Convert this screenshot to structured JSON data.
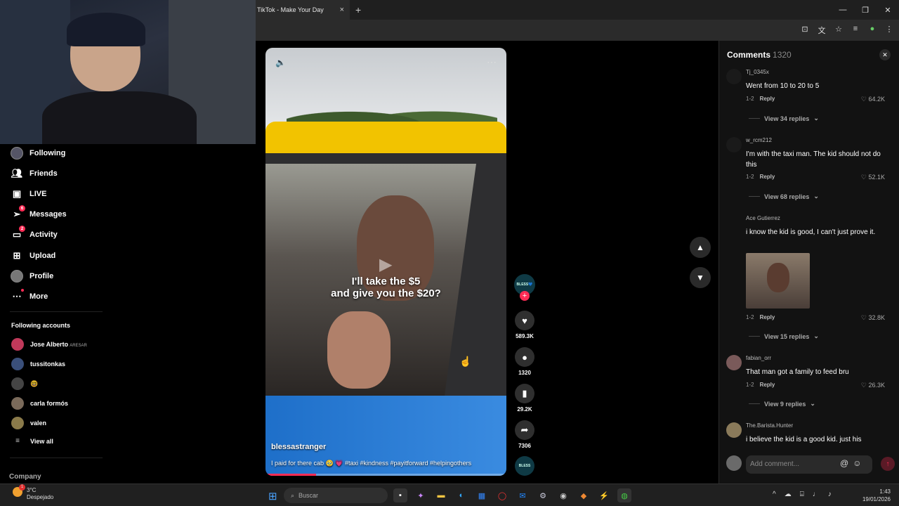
{
  "browser": {
    "tab_title": "TikTok - Make Your Day",
    "tab_close": "×",
    "new_tab": "+",
    "window_controls": [
      "—",
      "❐",
      "✕"
    ],
    "toolbar_icons": [
      "install-icon",
      "translate-icon",
      "star-icon",
      "media-icon",
      "profile-icon",
      "menu-icon"
    ]
  },
  "sidebar": {
    "items": [
      {
        "label": "Following",
        "icon": "avatar",
        "badge": ""
      },
      {
        "label": "Friends",
        "icon": "friends-icon",
        "badge": ""
      },
      {
        "label": "LIVE",
        "icon": "live-icon",
        "badge": ""
      },
      {
        "label": "Messages",
        "icon": "messages-icon",
        "badge": "6"
      },
      {
        "label": "Activity",
        "icon": "activity-icon",
        "badge": "2"
      },
      {
        "label": "Upload",
        "icon": "upload-icon",
        "badge": ""
      },
      {
        "label": "Profile",
        "icon": "avatar",
        "badge": ""
      },
      {
        "label": "More",
        "icon": "more-icon",
        "badge": ""
      }
    ],
    "following_title": "Following accounts",
    "accounts": [
      {
        "name": "Jose Alberto",
        "suffix": "ARESAR",
        "color": "#c0395a"
      },
      {
        "name": "tussitonkas",
        "suffix": "",
        "color": "#3a4f7a"
      },
      {
        "name": "🤓",
        "suffix": "",
        "color": "#444444"
      },
      {
        "name": "carla formós",
        "suffix": "",
        "color": "#7a6a5a"
      },
      {
        "name": "valen",
        "suffix": "",
        "color": "#8a7a4a"
      }
    ],
    "view_all": "View all",
    "company": "Company"
  },
  "video": {
    "caption": "I'll take the $5 and give you the $20?",
    "author": "blessastranger",
    "description": "I paid for there cab 🥹 💗 #taxi #kindness #payitforward #helpingothers",
    "progress": 0.21,
    "mute_icon": "🔈",
    "more_icon": "⋯",
    "play_icon": "▶"
  },
  "actions": {
    "creator_label": "BLESS💙",
    "likes": "589.3K",
    "comments": "1320",
    "saves": "29.2K",
    "shares": "7306",
    "music_label": "BLESS"
  },
  "comments": {
    "title": "Comments",
    "count": "1320",
    "close": "✕",
    "items": [
      {
        "user": "Tj_0345x",
        "text": "Went from 10 to 20 to 5",
        "date": "1-2",
        "reply": "Reply",
        "likes": "64.2K",
        "replies": "View 34 replies"
      },
      {
        "user": "w_rcm212",
        "text": "I'm with the taxi man. The kid should not do this",
        "date": "1-2",
        "reply": "Reply",
        "likes": "52.1K",
        "replies": "View 68 replies"
      },
      {
        "user": "Ace Gutierrez",
        "text": "i know the kid is good, I can't just prove it.",
        "date": "1-2",
        "reply": "Reply",
        "likes": "32.8K",
        "replies": "View 15 replies"
      },
      {
        "user": "fabian_orr",
        "text": "That man got a family to feed bru",
        "date": "1-2",
        "reply": "Reply",
        "likes": "26.3K",
        "replies": "View 9 replies"
      },
      {
        "user": "The.Barista.Hunter",
        "text": "i believe the kid is a good kid. just his",
        "date": "",
        "reply": "",
        "likes": "",
        "replies": ""
      }
    ],
    "input_placeholder": "Add comment...",
    "mention_icon": "@",
    "emoji_icon": "☺",
    "send_icon": "↑"
  },
  "taskbar": {
    "temp": "3°C",
    "weather": "Despejado",
    "search_placeholder": "Buscar",
    "time": "1:43",
    "date": "19/01/2026"
  }
}
